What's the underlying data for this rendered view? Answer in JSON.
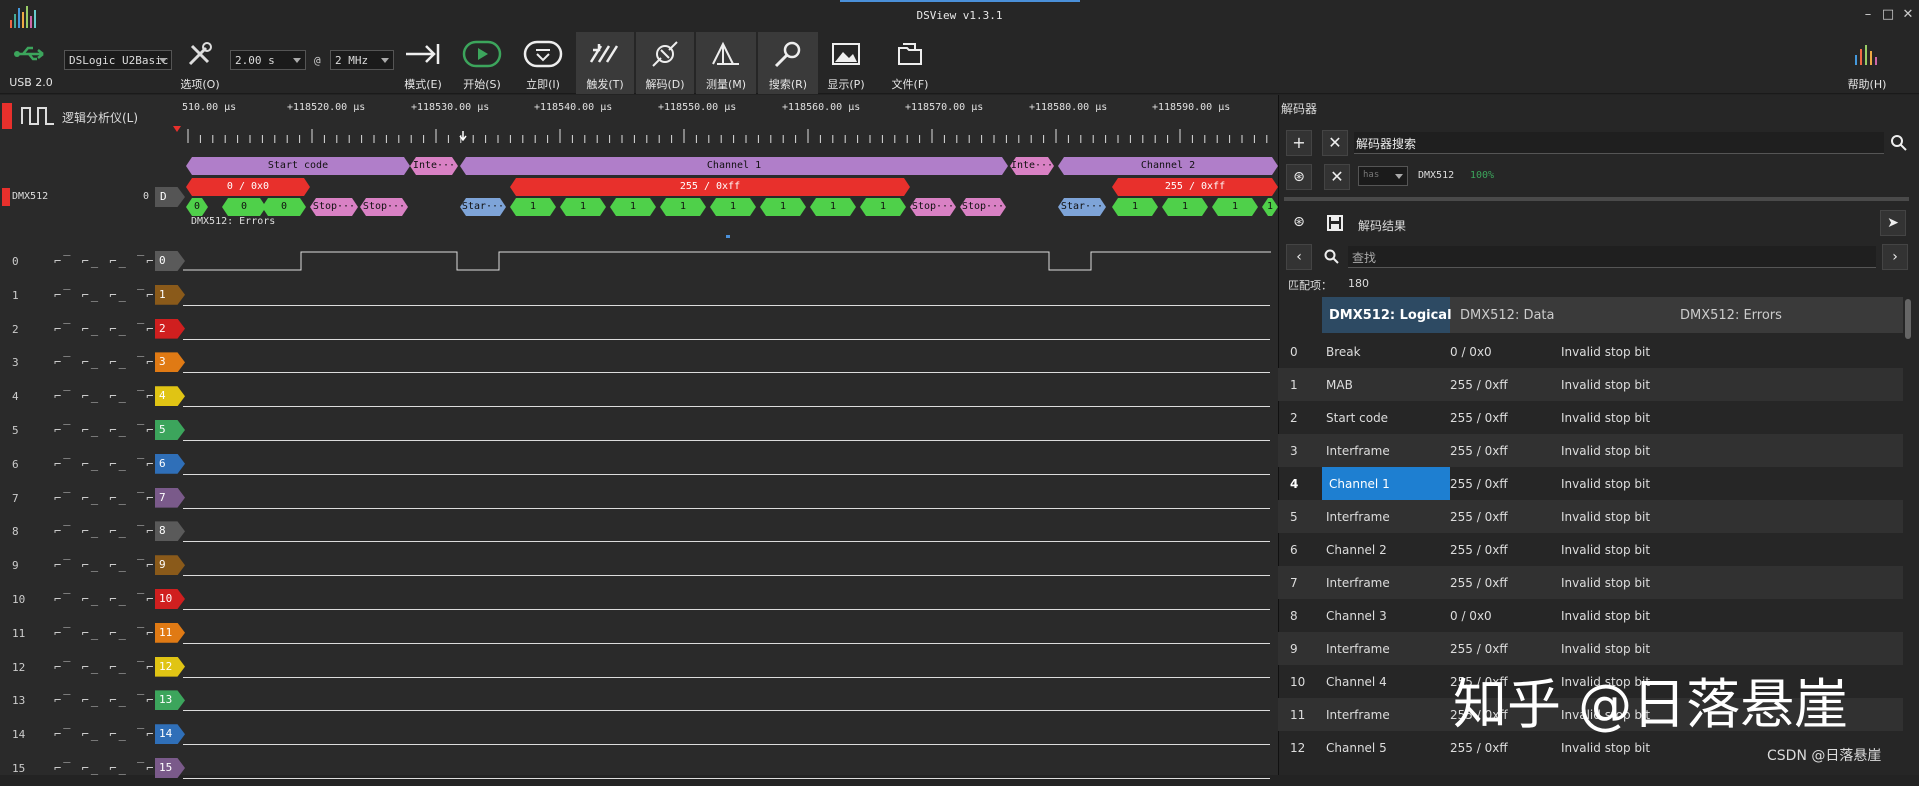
{
  "title": "DSView v1.3.1",
  "toolbar": {
    "usb_label": "USB 2.0",
    "device": "DSLogic U2Basic",
    "options_label": "选项(O)",
    "duration": "2.00 s",
    "at": "@",
    "samplerate": "2 MHz",
    "mode_label": "模式(E)",
    "start_label": "开始(S)",
    "instant_label": "立即(I)",
    "trigger_label": "触发(T)",
    "decode_label": "解码(D)",
    "measure_label": "测量(M)",
    "search_label": "搜索(R)",
    "display_label": "显示(P)",
    "file_label": "文件(F)",
    "help_label": "帮助(H)"
  },
  "colors": {
    "accent": "#1e7fd1",
    "decode_purple": "#b07ec9",
    "decode_red": "#e8302c",
    "decode_green": "#4fd04a",
    "decode_blue": "#7ea4d8",
    "decode_pink": "#d981c4"
  },
  "analyzer_label": "逻辑分析仪(L)",
  "ruler": {
    "labels": [
      "510.00 μs",
      "+118520.00 μs",
      "+118530.00 μs",
      "+118540.00 μs",
      "+118550.00 μs",
      "+118560.00 μs",
      "+118570.00 μs",
      "+118580.00 μs",
      "+118590.00 μs"
    ]
  },
  "decoder_track": {
    "name": "DMX512",
    "index": "0",
    "tag": "D",
    "errors_label": "DMX512: Errors",
    "row1": [
      "Start code",
      "Inte···",
      "Channel 1",
      "Inte···",
      "Channel 2"
    ],
    "row2": [
      "0 / 0x0",
      "255 / 0xff",
      "255 / 0xff"
    ],
    "row3": [
      "0",
      "0",
      "0",
      "Stop···",
      "Stop···",
      "Star···",
      "1",
      "1",
      "1",
      "1",
      "1",
      "1",
      "1",
      "1",
      "Stop···",
      "Stop···",
      "Star···",
      "1",
      "1",
      "1",
      "1"
    ]
  },
  "channels": [
    "0",
    "1",
    "2",
    "3",
    "4",
    "5",
    "6",
    "7",
    "8",
    "9",
    "10",
    "11",
    "12",
    "13",
    "14",
    "15"
  ],
  "channel_trigger_glyphs": "⌐‾ ⌐_ ⌐_ ‾⌐ ⌶",
  "rpanel": {
    "title": "解码器",
    "decoder_search": "解码器搜索",
    "decoder_select": "has",
    "decoder_name": "DMX512",
    "decoder_progress": "100%",
    "results_label": "解码结果",
    "find_placeholder": "查找",
    "match_label": "匹配项：",
    "match_count": "180",
    "columns": [
      "DMX512: Logical",
      "DMX512: Data",
      "DMX512: Errors"
    ],
    "rows": [
      {
        "idx": "0",
        "logical": "Break",
        "data": "0 / 0x0",
        "err": "Invalid stop bit"
      },
      {
        "idx": "1",
        "logical": "MAB",
        "data": "255 / 0xff",
        "err": "Invalid stop bit"
      },
      {
        "idx": "2",
        "logical": "Start code",
        "data": "255 / 0xff",
        "err": "Invalid stop bit"
      },
      {
        "idx": "3",
        "logical": "Interframe",
        "data": "255 / 0xff",
        "err": "Invalid stop bit"
      },
      {
        "idx": "4",
        "logical": "Channel 1",
        "data": "255 / 0xff",
        "err": "Invalid stop bit"
      },
      {
        "idx": "5",
        "logical": "Interframe",
        "data": "255 / 0xff",
        "err": "Invalid stop bit"
      },
      {
        "idx": "6",
        "logical": "Channel 2",
        "data": "255 / 0xff",
        "err": "Invalid stop bit"
      },
      {
        "idx": "7",
        "logical": "Interframe",
        "data": "255 / 0xff",
        "err": "Invalid stop bit"
      },
      {
        "idx": "8",
        "logical": "Channel 3",
        "data": "0 / 0x0",
        "err": "Invalid stop bit"
      },
      {
        "idx": "9",
        "logical": "Interframe",
        "data": "255 / 0xff",
        "err": "Invalid stop bit"
      },
      {
        "idx": "10",
        "logical": "Channel 4",
        "data": "255 / 0xff",
        "err": "Invalid stop bit"
      },
      {
        "idx": "11",
        "logical": "Interframe",
        "data": "255 / 0xff",
        "err": "Invalid stop bit"
      },
      {
        "idx": "12",
        "logical": "Channel 5",
        "data": "255 / 0xff",
        "err": "Invalid stop bit"
      }
    ]
  },
  "watermark": "知乎 @日落悬崖",
  "csdn": "CSDN @日落悬崖"
}
